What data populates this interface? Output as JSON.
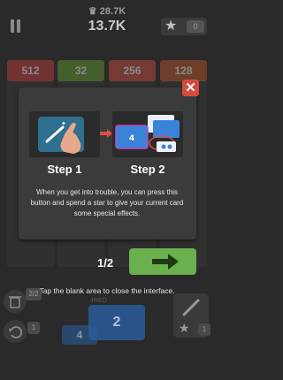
{
  "topbar": {
    "best_score": "28.7K",
    "score": "13.7K",
    "stars": "0"
  },
  "board": {
    "tiles": [
      "512",
      "32",
      "256",
      "128"
    ]
  },
  "tutorial": {
    "step1_label": "Step 1",
    "step2_label": "Step 2",
    "illustration_card_value": "4",
    "description": "When you get into trouble, you can press this button and spend a star to give your current card some special effects.",
    "page_indicator": "1/2",
    "close_hint": "Tap the blank area to close the interface."
  },
  "bottom": {
    "card_main": "2",
    "card_small": "4",
    "trash_count": "2/2",
    "undo_count": "1",
    "wand_count": "1",
    "pile_label": "4RED"
  },
  "colors": {
    "tile_512": "#b03a3a",
    "tile_32": "#5a8a2e",
    "tile_256": "#b04a3a",
    "tile_128": "#a8502c",
    "next_button": "#6ab04c",
    "close_button": "#d44a3e"
  }
}
